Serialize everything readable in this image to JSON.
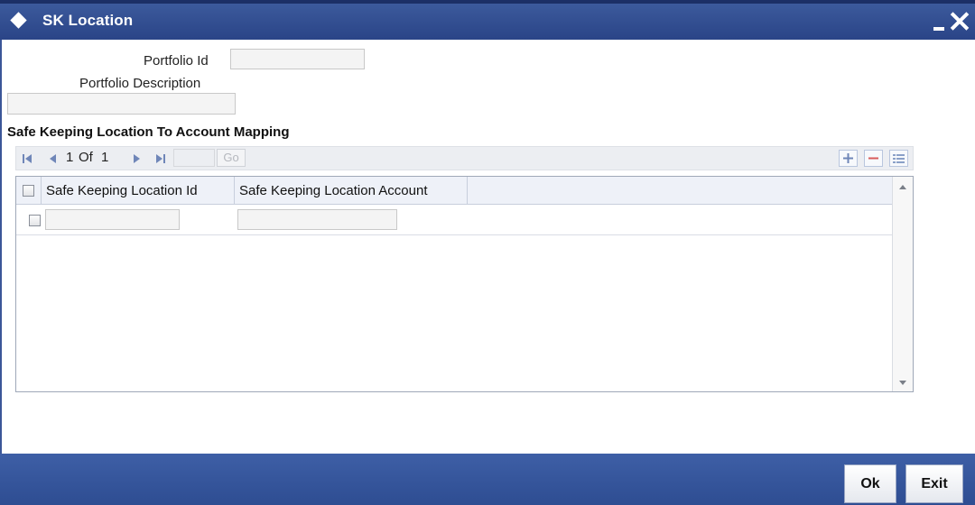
{
  "window": {
    "title": "SK Location",
    "icon": "diamond-icon"
  },
  "form": {
    "portfolio_id_label": "Portfolio Id",
    "portfolio_id_value": "",
    "portfolio_description_label": "Portfolio Description",
    "portfolio_description_value": ""
  },
  "section": {
    "title": "Safe Keeping Location To Account Mapping"
  },
  "pagination": {
    "current_page": "1",
    "of_label": "Of",
    "total_pages": "1",
    "page_input": "",
    "go_label": "Go"
  },
  "grid": {
    "columns": [
      "Safe Keeping Location Id",
      "Safe Keeping Location Account"
    ],
    "rows": [
      {
        "location_id": "",
        "location_account": ""
      }
    ]
  },
  "footer": {
    "ok_label": "Ok",
    "exit_label": "Exit"
  },
  "colors": {
    "titlebar": "#2e4d92",
    "footer": "#3e5fa6",
    "window_bg": "#ffffff"
  }
}
